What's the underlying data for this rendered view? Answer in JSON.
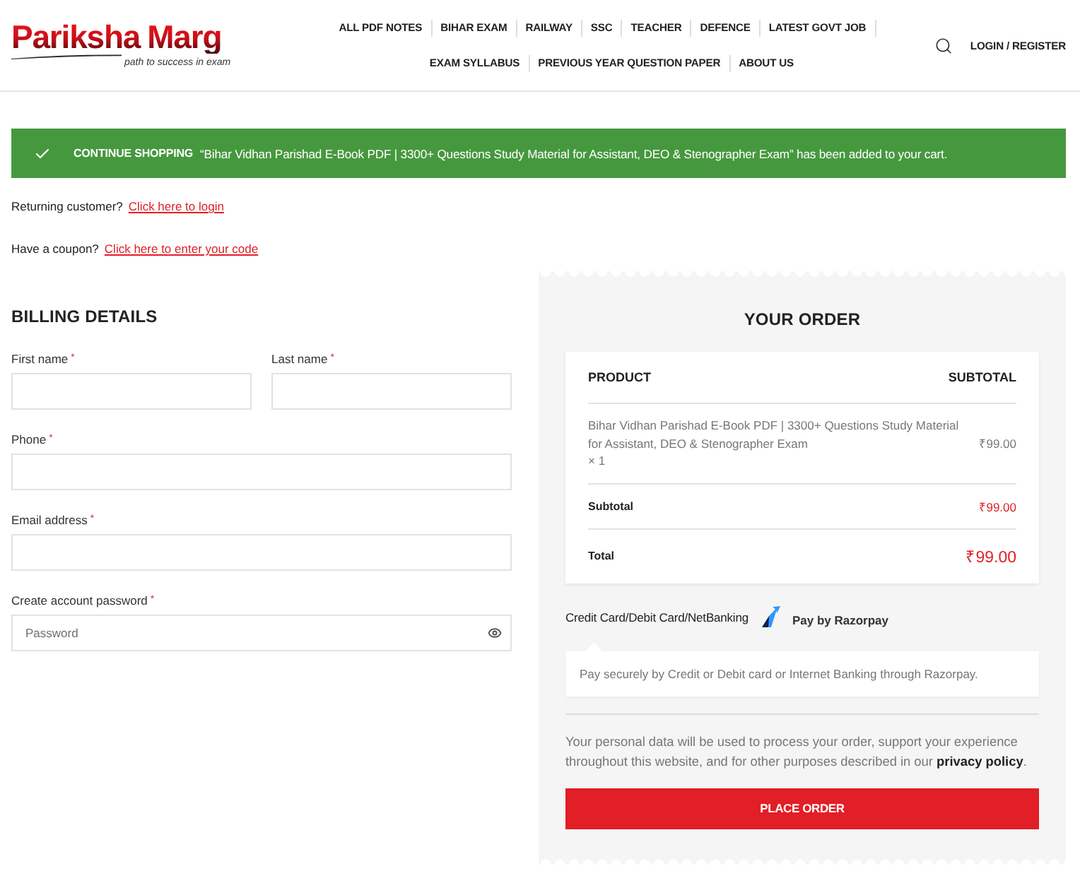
{
  "header": {
    "logo": {
      "name_first": "Pariksha",
      "name_second": "Marg",
      "tagline": "path to success in exam"
    },
    "nav_rows": [
      [
        "ALL PDF NOTES",
        "BIHAR EXAM",
        "RAILWAY",
        "SSC",
        "TEACHER",
        "DEFENCE",
        "LATEST GOVT JOB"
      ],
      [
        "EXAM SYLLABUS",
        "PREVIOUS YEAR QUESTION PAPER",
        "ABOUT US"
      ]
    ],
    "account_link": "LOGIN / REGISTER"
  },
  "notice": {
    "action": "CONTINUE SHOPPING",
    "message": "“Bihar Vidhan Parishad E-Book PDF | 3300+ Questions Study Material for Assistant, DEO & Stenographer Exam” has been added to your cart."
  },
  "prompts": [
    {
      "question": "Returning customer?",
      "link": "Click here to login"
    },
    {
      "question": "Have a coupon?",
      "link": "Click here to enter your code"
    }
  ],
  "billing": {
    "title": "BILLING DETAILS",
    "rows": [
      [
        {
          "kind": "text",
          "label": "First name",
          "required_mark": "*"
        },
        {
          "kind": "text",
          "label": "Last name",
          "required_mark": "*"
        }
      ],
      [
        {
          "kind": "text",
          "label": "Phone",
          "required_mark": "*"
        }
      ],
      [
        {
          "kind": "text",
          "label": "Email address",
          "required_mark": "*"
        }
      ],
      [
        {
          "kind": "password",
          "label": "Create account password",
          "required_mark": "*",
          "placeholder": "Password"
        }
      ]
    ]
  },
  "order": {
    "title": "YOUR ORDER",
    "columns": [
      "PRODUCT",
      "SUBTOTAL"
    ],
    "items": [
      {
        "name": "Bihar Vidhan Parishad E-Book PDF | 3300+ Questions Study Material for Assistant, DEO & Stenographer Exam",
        "quantity": "× 1",
        "price": "₹99.00"
      }
    ],
    "totals": [
      {
        "kind": "subtotal",
        "label": "Subtotal",
        "value": "₹99.00"
      },
      {
        "kind": "total",
        "label": "Total",
        "value": "₹99.00"
      }
    ]
  },
  "payment": {
    "method": "Credit Card/Debit Card/NetBanking",
    "provider": "Pay by Razorpay",
    "description": "Pay securely by Credit or Debit card or Internet Banking through Razorpay."
  },
  "privacy": {
    "text": "Your personal data will be used to process your order, support your experience throughout this website, and for other purposes described in our",
    "link": "privacy policy",
    "after": "."
  },
  "place_order": "PLACE ORDER"
}
